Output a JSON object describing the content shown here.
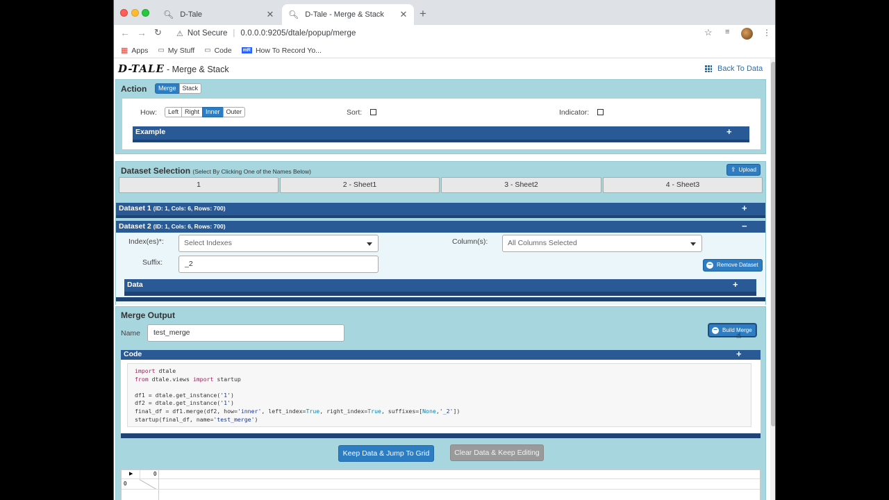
{
  "browser": {
    "tabs": [
      {
        "title": "D-Tale",
        "active": false
      },
      {
        "title": "D-Tale - Merge & Stack",
        "active": true
      }
    ],
    "security_label": "Not Secure",
    "url": "0.0.0.0:9205/dtale/popup/merge",
    "bookmarks": [
      "Apps",
      "My Stuff",
      "Code",
      "How To Record Yo..."
    ]
  },
  "header": {
    "logo": "D-TALE",
    "title": "- Merge & Stack",
    "back_link": "Back To Data"
  },
  "action": {
    "title": "Action",
    "modes": [
      "Merge",
      "Stack"
    ],
    "selected_mode": "Merge",
    "how_label": "How:",
    "how_options": [
      "Left",
      "Right",
      "Inner",
      "Outer"
    ],
    "selected_how": "Inner",
    "sort_label": "Sort:",
    "indicator_label": "Indicator:",
    "example_label": "Example"
  },
  "dataset_selection": {
    "title": "Dataset Selection",
    "subtitle": "(Select By Clicking One of the Names Below)",
    "upload_label": "Upload",
    "datasets": [
      "1",
      "2 - Sheet1",
      "3 - Sheet2",
      "4 - Sheet3"
    ]
  },
  "dataset1": {
    "title": "Dataset 1",
    "meta": "(ID: 1, Cols: 6, Rows: 700)"
  },
  "dataset2": {
    "title": "Dataset 2",
    "meta": "(ID: 1, Cols: 6, Rows: 700)",
    "index_label": "Index(es)*:",
    "index_placeholder": "Select Indexes",
    "columns_label": "Column(s):",
    "columns_value": "All Columns Selected",
    "suffix_label": "Suffix:",
    "suffix_value": "_2",
    "remove_label": "Remove Dataset",
    "data_label": "Data"
  },
  "merge_output": {
    "title": "Merge Output",
    "name_label": "Name",
    "name_value": "test_merge",
    "build_label": "Build Merge",
    "code_label": "Code",
    "keep_label": "Keep Data & Jump To Grid",
    "clear_label": "Clear Data & Keep Editing"
  },
  "grid": {
    "col_header": "0",
    "row_header": "0"
  },
  "colors": {
    "panel": "#a7d6df",
    "bar": "#2a5a95",
    "primary": "#2e7dc2"
  }
}
